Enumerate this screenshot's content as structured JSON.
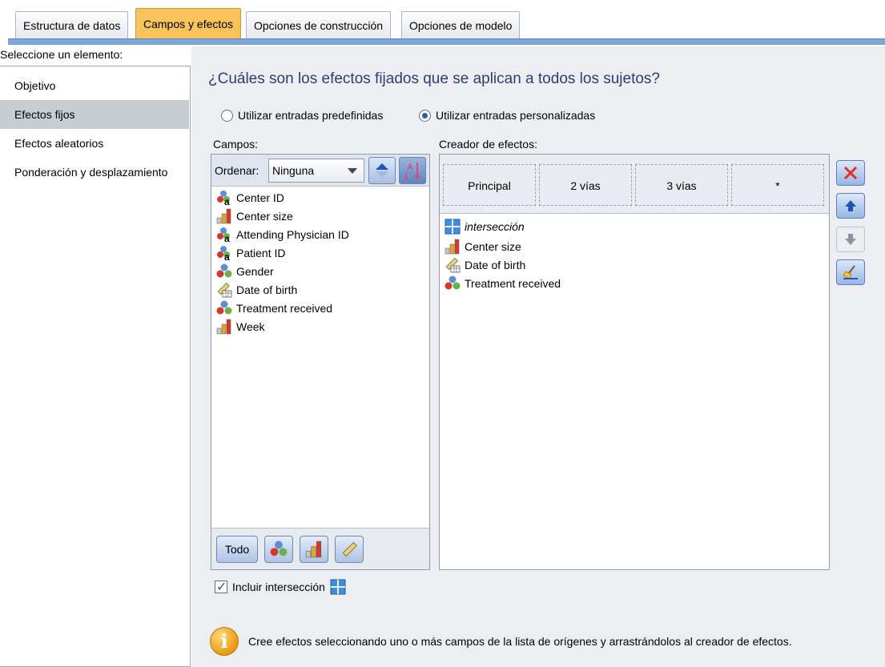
{
  "tabs": [
    {
      "label": "Estructura de datos",
      "active": false
    },
    {
      "label": "Campos y efectos",
      "active": true
    },
    {
      "label": "Opciones de construcción",
      "active": false
    },
    {
      "label": "Opciones de modelo",
      "active": false
    }
  ],
  "left": {
    "heading": "Seleccione un elemento:",
    "items": [
      "Objetivo",
      "Efectos fijos",
      "Efectos aleatorios",
      "Ponderación y desplazamiento"
    ],
    "selected": "Efectos fijos"
  },
  "main": {
    "question": "¿Cuáles son los efectos fijados que se aplican a todos los sujetos?",
    "radio_predef": "Utilizar entradas predefinidas",
    "radio_custom": "Utilizar entradas personalizadas",
    "selected_radio": "custom",
    "fields_label": "Campos:",
    "builder_label": "Creador de efectos:",
    "sort_label": "Ordenar:",
    "sort_value": "Ninguna",
    "fields": [
      {
        "name": "Center ID",
        "icon": "nominal-text-icon"
      },
      {
        "name": "Center size",
        "icon": "ordinal-icon"
      },
      {
        "name": "Attending Physician ID",
        "icon": "nominal-text-icon"
      },
      {
        "name": "Patient ID",
        "icon": "nominal-text-icon"
      },
      {
        "name": "Gender",
        "icon": "nominal-icon"
      },
      {
        "name": "Date of birth",
        "icon": "scale-date-icon"
      },
      {
        "name": "Treatment received",
        "icon": "nominal-icon"
      },
      {
        "name": "Week",
        "icon": "ordinal-icon"
      }
    ],
    "footer_all": "Todo",
    "builder_columns": [
      "Principal",
      "2 vías",
      "3 vías",
      "*"
    ],
    "effects": [
      {
        "name": "intersección",
        "icon": "intercept-icon",
        "italic": true
      },
      {
        "name": "Center size",
        "icon": "ordinal-icon"
      },
      {
        "name": "Date of birth",
        "icon": "scale-date-icon"
      },
      {
        "name": "Treatment received",
        "icon": "nominal-icon"
      }
    ],
    "include_intercept": "Incluir intersección",
    "include_intercept_checked": true,
    "info": "Cree efectos seleccionando uno o más campos de la lista de orígenes y arrastrándolos al creador de efectos."
  },
  "colors": {
    "active_tab": "#f7c35a",
    "tab_strip": "#7fa6d6",
    "question_text": "#2a3f73"
  }
}
